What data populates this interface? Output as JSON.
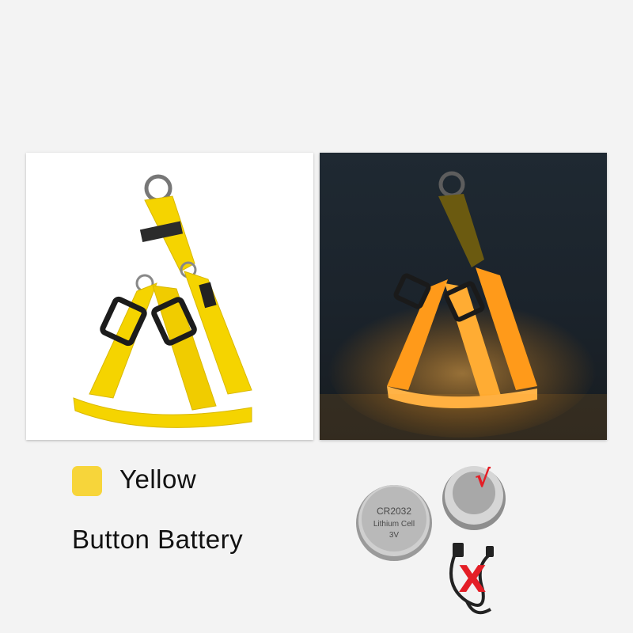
{
  "images": {
    "day_photo": {
      "subject": "yellow LED dog harness"
    },
    "night_photo": {
      "subject": "yellow LED dog harness glowing"
    }
  },
  "color_option": {
    "swatch_color": "#f7d53a",
    "label": "Yellow"
  },
  "power": {
    "label": "Button Battery",
    "battery_primary_text": [
      "CR2032",
      "Lithium Cell",
      "3V"
    ],
    "included_mark": "√",
    "excluded_mark": "X",
    "included_icon": "coin-battery-icon",
    "excluded_icon": "usb-cable-icon"
  },
  "colors": {
    "harness_yellow": "#f5d400",
    "glow_orange": "#ff9a1a",
    "check_red": "#e41e26"
  }
}
